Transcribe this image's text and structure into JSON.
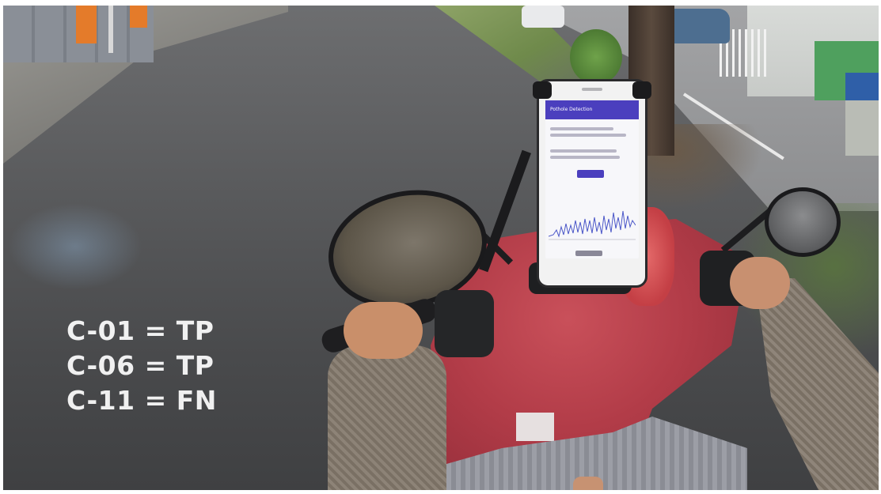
{
  "overlay": {
    "lines": [
      "C-01 = TP",
      "C-06 = TP",
      "C-11 = FN"
    ]
  },
  "phone_app": {
    "title": "Pothole Detection"
  },
  "scene": {
    "colors": {
      "road": "#5b5c5e",
      "scooter": "#b23c48",
      "overlay_text": "#ffffff",
      "app_bar": "#4b3fbe"
    }
  }
}
